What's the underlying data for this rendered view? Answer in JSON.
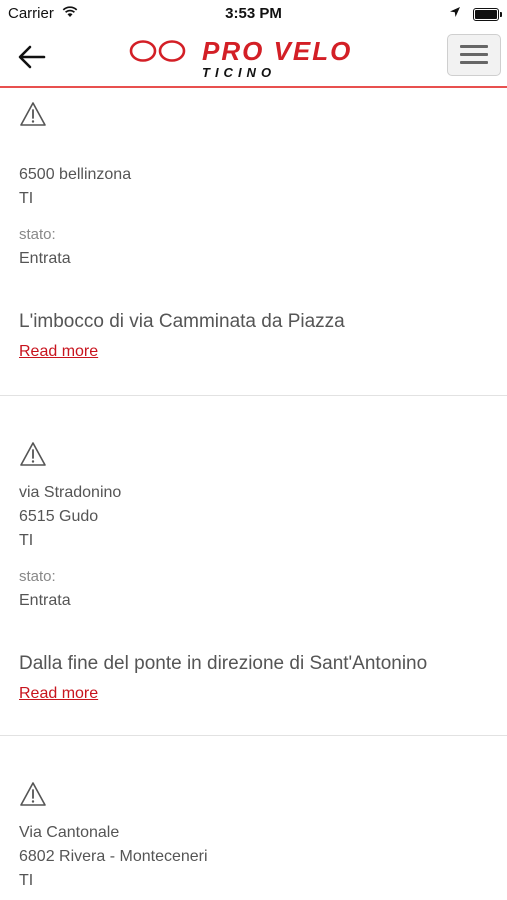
{
  "status_bar": {
    "carrier": "Carrier",
    "time": "3:53 PM"
  },
  "header": {
    "logo_main": "PRO VELO",
    "logo_sub": "TICINO",
    "back_icon": "arrow-left-icon",
    "menu_icon": "hamburger-menu-icon"
  },
  "colors": {
    "brand_red": "#d31f26",
    "header_rule": "#e8504f",
    "link": "#c8141e"
  },
  "entries": [
    {
      "address": [
        "6500 bellinzona",
        "TI"
      ],
      "stato_label": "stato:",
      "stato_value": "Entrata",
      "description": "L'imbocco di via Camminata da Piazza",
      "read_more": "Read more"
    },
    {
      "address": [
        "via Stradonino",
        "6515 Gudo",
        "TI"
      ],
      "stato_label": "stato:",
      "stato_value": "Entrata",
      "description": "Dalla fine del ponte in direzione di Sant'Antonino",
      "read_more": "Read more"
    },
    {
      "address": [
        "Via Cantonale",
        "6802 Rivera - Monteceneri",
        "TI"
      ]
    }
  ]
}
